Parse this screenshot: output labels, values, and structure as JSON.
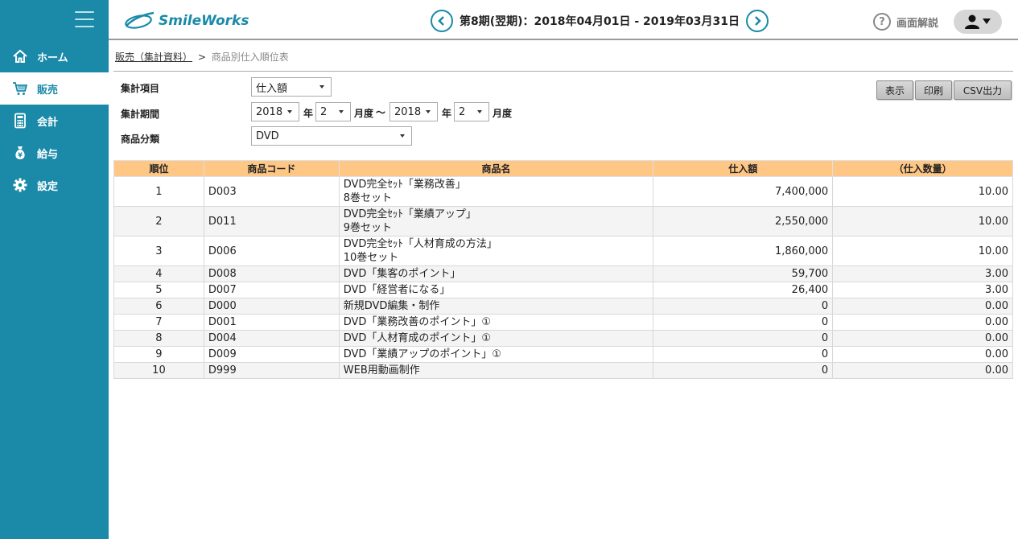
{
  "app": {
    "logo_text": "SmileWorks",
    "period_text": "第8期(翌期)：2018年04月01日 - 2019年03月31日",
    "help_label": "画面解説",
    "brand_color": "#1a8aa8"
  },
  "sidebar": {
    "items": [
      {
        "label": "ホーム",
        "icon": "home-icon"
      },
      {
        "label": "販売",
        "icon": "cart-icon"
      },
      {
        "label": "会計",
        "icon": "calculator-icon"
      },
      {
        "label": "給与",
        "icon": "money-bag-icon"
      },
      {
        "label": "設定",
        "icon": "gear-icon"
      }
    ],
    "active": "販売"
  },
  "breadcrumb": {
    "parent": "販売（集計資料）",
    "separator": ">",
    "current": "商品別仕入順位表"
  },
  "filters": {
    "item_label": "集計項目",
    "item_value": "仕入額",
    "period_label": "集計期間",
    "from_year": "2018",
    "from_month": "2",
    "to_year": "2018",
    "to_month": "2",
    "year_unit": "年",
    "month_unit": "月度",
    "range_sep": "〜",
    "category_label": "商品分類",
    "category_value": "DVD"
  },
  "buttons": {
    "display": "表示",
    "print": "印刷",
    "csv": "CSV出力"
  },
  "table": {
    "headers": [
      "順位",
      "商品コード",
      "商品名",
      "仕入額",
      "（仕入数量）"
    ],
    "rows": [
      {
        "rank": "1",
        "code": "D003",
        "name": [
          "DVD完全ｾｯﾄ「業務改善」",
          "8巻セット"
        ],
        "amount": "7,400,000",
        "qty": "10.00"
      },
      {
        "rank": "2",
        "code": "D011",
        "name": [
          "DVD完全ｾｯﾄ「業績アップ」",
          "9巻セット"
        ],
        "amount": "2,550,000",
        "qty": "10.00"
      },
      {
        "rank": "3",
        "code": "D006",
        "name": [
          "DVD完全ｾｯﾄ「人材育成の方法」",
          "10巻セット"
        ],
        "amount": "1,860,000",
        "qty": "10.00"
      },
      {
        "rank": "4",
        "code": "D008",
        "name": [
          "DVD「集客のポイント」"
        ],
        "amount": "59,700",
        "qty": "3.00"
      },
      {
        "rank": "5",
        "code": "D007",
        "name": [
          "DVD「経営者になる」"
        ],
        "amount": "26,400",
        "qty": "3.00"
      },
      {
        "rank": "6",
        "code": "D000",
        "name": [
          "新規DVD編集・制作"
        ],
        "amount": "0",
        "qty": "0.00"
      },
      {
        "rank": "7",
        "code": "D001",
        "name": [
          "DVD「業務改善のポイント」①"
        ],
        "amount": "0",
        "qty": "0.00"
      },
      {
        "rank": "8",
        "code": "D004",
        "name": [
          "DVD「人材育成のポイント」①"
        ],
        "amount": "0",
        "qty": "0.00"
      },
      {
        "rank": "9",
        "code": "D009",
        "name": [
          "DVD「業績アップのポイント」①"
        ],
        "amount": "0",
        "qty": "0.00"
      },
      {
        "rank": "10",
        "code": "D999",
        "name": [
          "WEB用動画制作"
        ],
        "amount": "0",
        "qty": "0.00"
      }
    ]
  }
}
